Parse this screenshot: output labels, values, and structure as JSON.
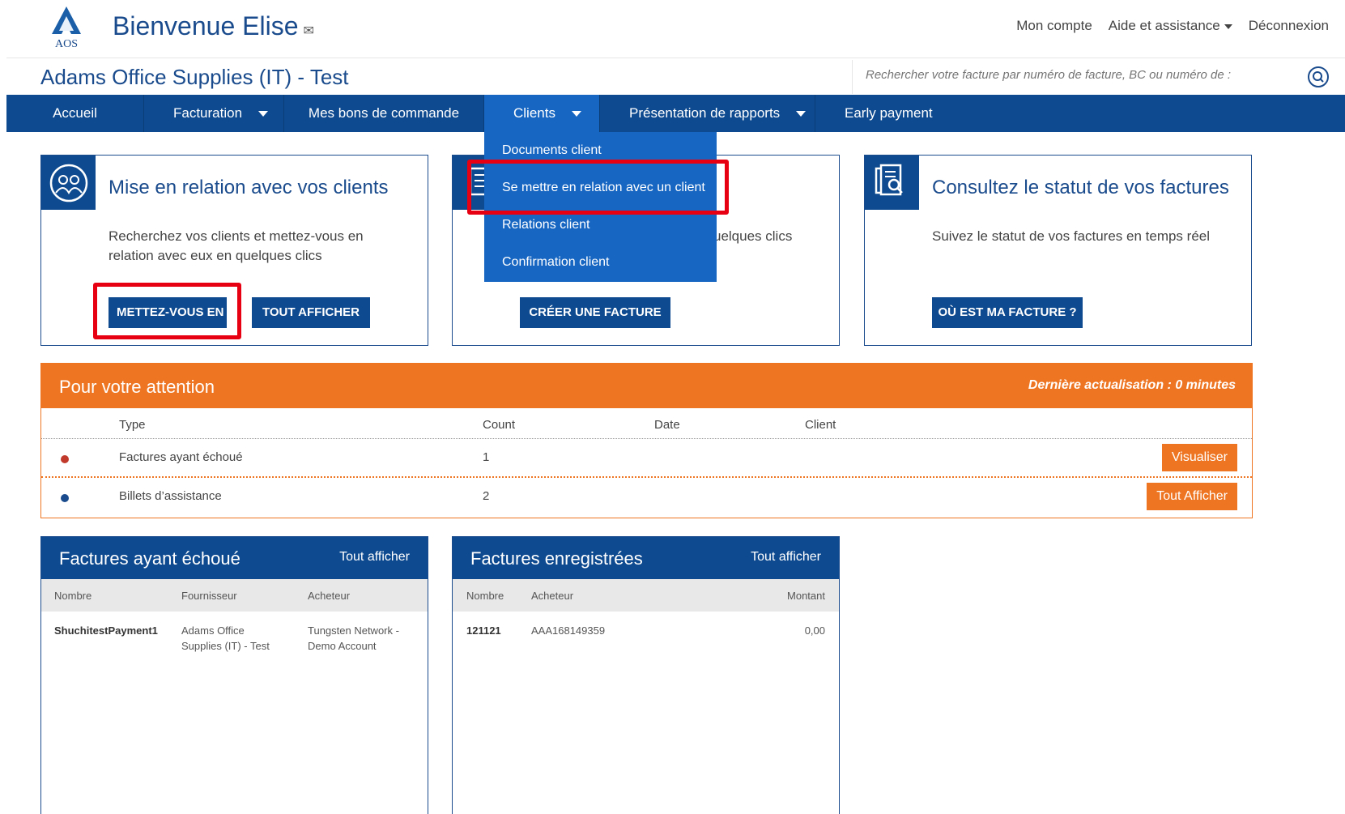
{
  "header": {
    "welcome": "Bienvenue Elise",
    "logo_text": "AOS",
    "links": {
      "account": "Mon compte",
      "help": "Aide et assistance",
      "logout": "Déconnexion"
    }
  },
  "company": "Adams Office Supplies (IT) - Test",
  "search": {
    "placeholder": "Rechercher votre facture par numéro de facture, BC ou numéro de :"
  },
  "nav": {
    "home": "Accueil",
    "billing": "Facturation",
    "orders": "Mes bons de commande",
    "clients": "Clients",
    "reports": "Présentation de rapports",
    "early": "Early payment"
  },
  "dropdown": {
    "items": [
      "Documents client",
      "Se mettre en relation avec un client",
      "Relations client",
      "Confirmation client"
    ]
  },
  "cards": {
    "connect": {
      "title": "Mise en relation avec vos clients",
      "desc": "Recherchez vos clients et mettez-vous en relation avec eux en quelques clics",
      "btn_connect": "METTEZ-VOUS EN RELATION",
      "btn_all": "TOUT AFFICHER"
    },
    "invoice": {
      "desc_fragment": "uelques clics",
      "btn": "CRÉER UNE FACTURE"
    },
    "status": {
      "title": "Consultez le statut de vos factures",
      "desc": "Suivez le statut de vos factures en temps réel",
      "btn": "OÙ EST MA FACTURE ?"
    }
  },
  "attention": {
    "title": "Pour votre attention",
    "updated": "Dernière actualisation : 0 minutes",
    "columns": {
      "type": "Type",
      "count": "Count",
      "date": "Date",
      "client": "Client"
    },
    "rows": [
      {
        "type": "Factures ayant échoué",
        "count": "1",
        "action": "Visualiser",
        "dot_color": "#c0392b"
      },
      {
        "type": "Billets d’assistance",
        "count": "2",
        "action": "Tout Afficher",
        "dot_color": "#1a4b8c"
      }
    ]
  },
  "failed": {
    "title": "Factures ayant échoué",
    "all": "Tout afficher",
    "columns": {
      "number": "Nombre",
      "supplier": "Fournisseur",
      "buyer": "Acheteur"
    },
    "rows": [
      {
        "number": "ShuchitestPayment1",
        "supplier_l1": "Adams Office",
        "supplier_l2": "Supplies (IT) - Test",
        "buyer_l1": "Tungsten Network -",
        "buyer_l2": "Demo Account"
      }
    ]
  },
  "registered": {
    "title": "Factures enregistrées",
    "all": "Tout afficher",
    "columns": {
      "number": "Nombre",
      "buyer": "Acheteur",
      "amount": "Montant"
    },
    "rows": [
      {
        "number": "121121",
        "buyer": "AAA168149359",
        "amount": "0,00"
      }
    ]
  },
  "colors": {
    "primary": "#0e4a8f",
    "accent": "#ee7623",
    "highlight": "#e60012",
    "dropdown": "#1766c2"
  }
}
